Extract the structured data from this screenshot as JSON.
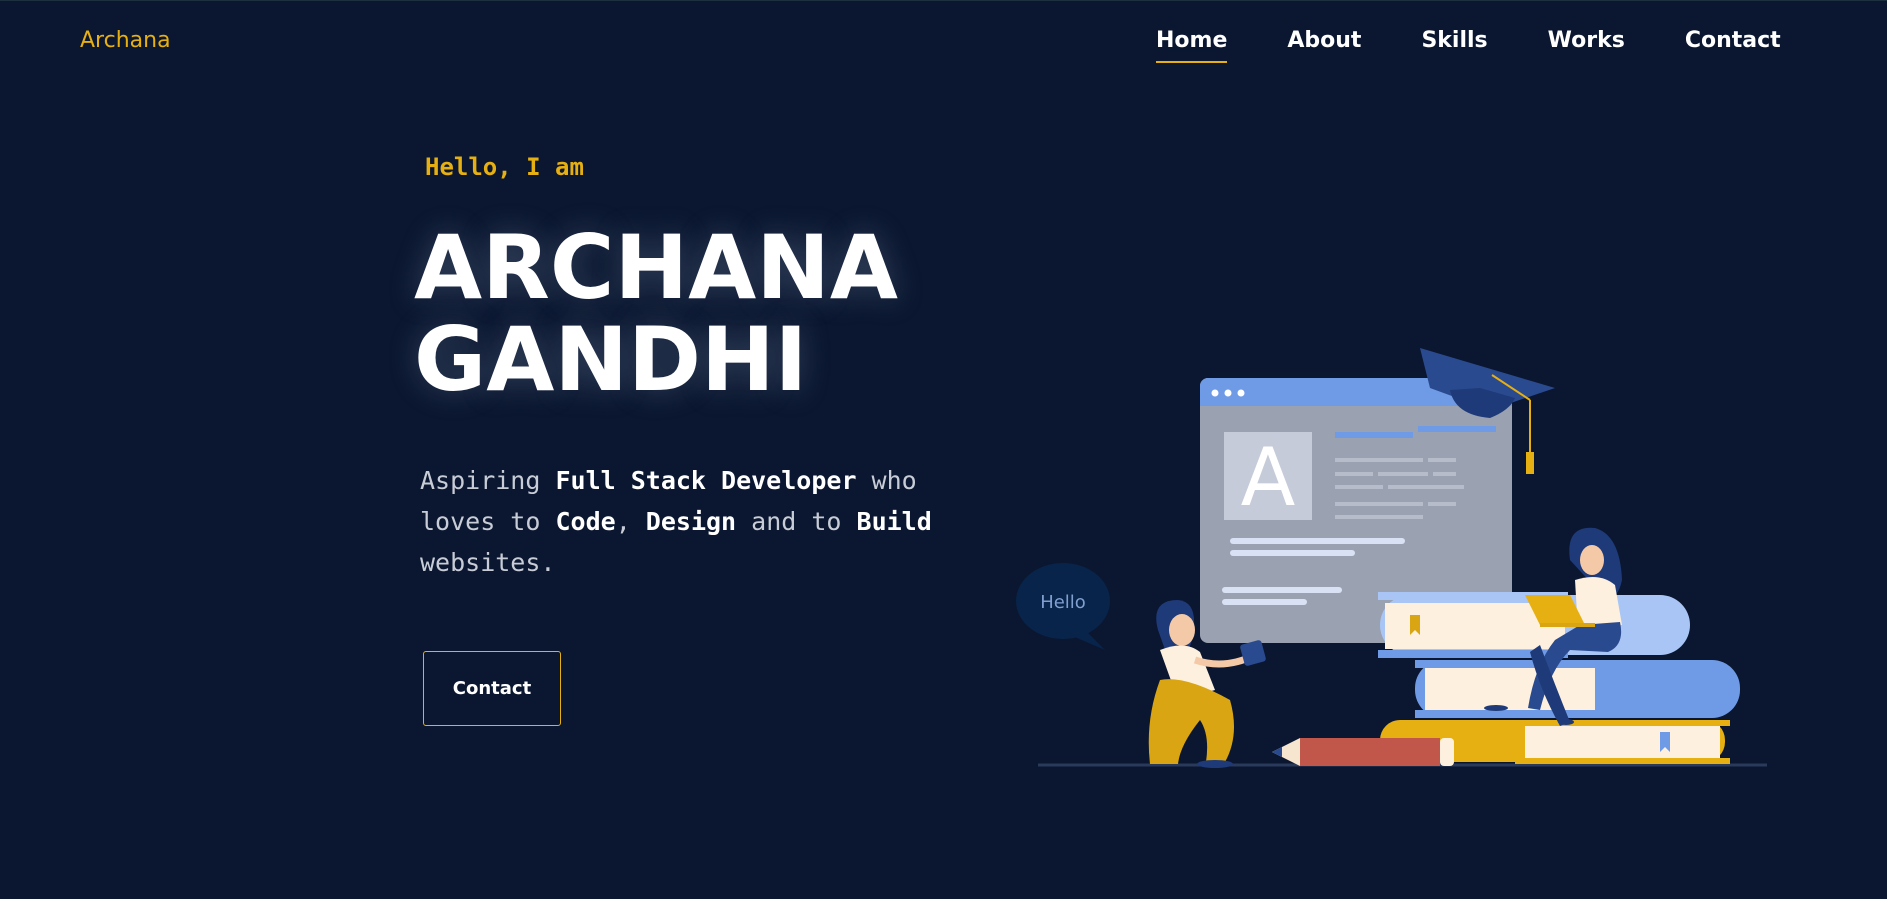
{
  "brand": {
    "logo_text": "Archana",
    "accent": "#e6b012",
    "background": "#0b1730"
  },
  "nav": {
    "items": [
      {
        "label": "Home",
        "active": true
      },
      {
        "label": "About",
        "active": false
      },
      {
        "label": "Skills",
        "active": false
      },
      {
        "label": "Works",
        "active": false
      },
      {
        "label": "Contact",
        "active": false
      }
    ]
  },
  "hero": {
    "greeting": "Hello, I am",
    "name_line1": "ARCHANA",
    "name_line2": "GANDHI",
    "tagline": {
      "t1": "Aspiring ",
      "b1": "Full Stack Developer",
      "t2": " who loves to ",
      "b2": "Code",
      "t3": ", ",
      "b3": "Design",
      "t4": " and to ",
      "b4": "Build",
      "t5": " websites."
    },
    "cta_label": "Contact"
  },
  "illustration": {
    "bubble_text": "Hello",
    "card_letter": "A",
    "icons": [
      "speech-bubble",
      "browser-window",
      "graduation-cap",
      "book-stack",
      "pencil",
      "laptop"
    ]
  }
}
